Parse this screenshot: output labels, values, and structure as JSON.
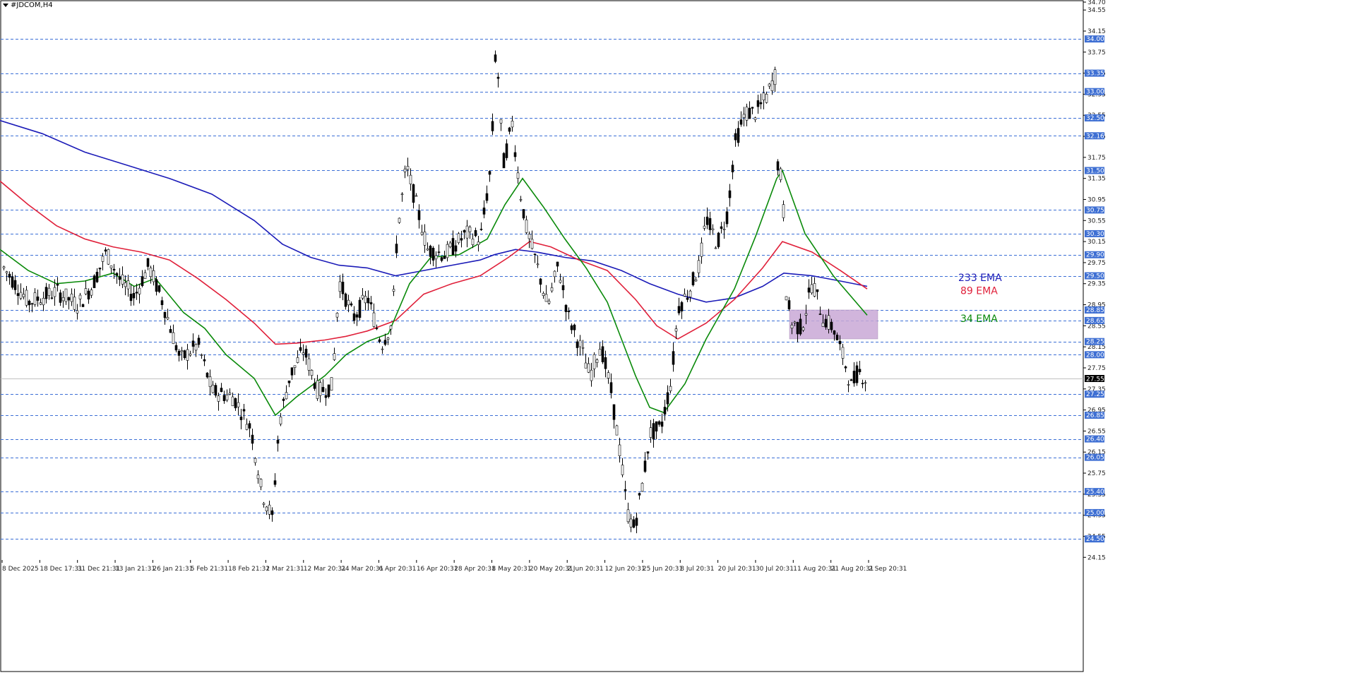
{
  "symbol": "#JDCOM,H4",
  "colors": {
    "grid_line": "#3c6fd6",
    "level_badge": "#3e6fd3",
    "current_badge": "#000000",
    "ema34": "#0a8a0a",
    "ema89": "#e0203a",
    "ema233": "#1b1bb8",
    "zone_fill": "#c9a8d6",
    "candle": "#000000"
  },
  "chart_data": {
    "type": "candlestick",
    "ylim": [
      24.1,
      34.7
    ],
    "price_ticks": [
      "34.70",
      "34.55",
      "34.15",
      "33.75",
      "33.35",
      "32.95",
      "32.55",
      "32.15",
      "31.75",
      "31.35",
      "30.95",
      "30.55",
      "30.15",
      "29.75",
      "29.35",
      "28.95",
      "28.55",
      "28.15",
      "27.75",
      "27.35",
      "26.95",
      "26.55",
      "26.15",
      "25.75",
      "25.35",
      "24.95",
      "24.55",
      "24.15"
    ],
    "horizontal_levels": [
      "34.00",
      "33.35",
      "33.00",
      "32.50",
      "32.16",
      "31.50",
      "30.75",
      "30.30",
      "29.90",
      "29.50",
      "28.85",
      "28.65",
      "28.25",
      "28.00",
      "27.25",
      "26.85",
      "26.40",
      "26.05",
      "25.40",
      "25.00",
      "24.50"
    ],
    "current_price": "27.55",
    "time_labels": [
      "8 Dec 2025",
      "18 Dec 17:31",
      "31 Dec 21:31",
      "13 Jan 21:31",
      "26 Jan 21:31",
      "5 Feb 21:31",
      "18 Feb 21:31",
      "2 Mar 21:31",
      "12 Mar 20:31",
      "24 Mar 20:31",
      "6 Apr 20:31",
      "16 Apr 20:31",
      "28 Apr 20:31",
      "8 May 20:31",
      "20 May 20:31",
      "2 Jun 20:31",
      "12 Jun 20:31",
      "25 Jun 20:31",
      "8 Jul 20:31",
      "20 Jul 20:31",
      "30 Jul 20:31",
      "11 Aug 20:31",
      "21 Aug 20:31",
      "2 Sep 20:31"
    ],
    "series": [
      {
        "name": "233 EMA",
        "color": "#1b1bb8",
        "values": [
          [
            0,
            32.45
          ],
          [
            60,
            32.2
          ],
          [
            120,
            31.85
          ],
          [
            180,
            31.6
          ],
          [
            240,
            31.35
          ],
          [
            300,
            31.05
          ],
          [
            360,
            30.55
          ],
          [
            400,
            30.1
          ],
          [
            440,
            29.85
          ],
          [
            480,
            29.7
          ],
          [
            520,
            29.65
          ],
          [
            560,
            29.5
          ],
          [
            600,
            29.6
          ],
          [
            640,
            29.7
          ],
          [
            680,
            29.8
          ],
          [
            700,
            29.9
          ],
          [
            730,
            30.0
          ],
          [
            760,
            29.95
          ],
          [
            800,
            29.85
          ],
          [
            840,
            29.78
          ],
          [
            880,
            29.6
          ],
          [
            920,
            29.35
          ],
          [
            960,
            29.15
          ],
          [
            1000,
            29.0
          ],
          [
            1040,
            29.08
          ],
          [
            1080,
            29.3
          ],
          [
            1110,
            29.55
          ],
          [
            1150,
            29.5
          ],
          [
            1190,
            29.4
          ],
          [
            1228,
            29.3
          ]
        ]
      },
      {
        "name": "89 EMA",
        "color": "#e0203a",
        "values": [
          [
            0,
            31.3
          ],
          [
            40,
            30.85
          ],
          [
            80,
            30.45
          ],
          [
            120,
            30.2
          ],
          [
            160,
            30.05
          ],
          [
            200,
            29.95
          ],
          [
            240,
            29.8
          ],
          [
            280,
            29.45
          ],
          [
            320,
            29.05
          ],
          [
            360,
            28.6
          ],
          [
            390,
            28.2
          ],
          [
            420,
            28.22
          ],
          [
            460,
            28.28
          ],
          [
            490,
            28.35
          ],
          [
            520,
            28.45
          ],
          [
            560,
            28.65
          ],
          [
            600,
            29.15
          ],
          [
            640,
            29.35
          ],
          [
            680,
            29.5
          ],
          [
            720,
            29.85
          ],
          [
            750,
            30.15
          ],
          [
            780,
            30.05
          ],
          [
            820,
            29.8
          ],
          [
            860,
            29.6
          ],
          [
            900,
            29.05
          ],
          [
            930,
            28.55
          ],
          [
            960,
            28.3
          ],
          [
            1000,
            28.6
          ],
          [
            1040,
            29.05
          ],
          [
            1080,
            29.65
          ],
          [
            1108,
            30.15
          ],
          [
            1150,
            29.95
          ],
          [
            1190,
            29.6
          ],
          [
            1228,
            29.25
          ]
        ]
      },
      {
        "name": "34 EMA",
        "color": "#0a8a0a",
        "values": [
          [
            0,
            30.0
          ],
          [
            40,
            29.6
          ],
          [
            80,
            29.35
          ],
          [
            120,
            29.4
          ],
          [
            160,
            29.55
          ],
          [
            190,
            29.3
          ],
          [
            220,
            29.45
          ],
          [
            260,
            28.8
          ],
          [
            290,
            28.5
          ],
          [
            320,
            28.0
          ],
          [
            360,
            27.55
          ],
          [
            390,
            26.85
          ],
          [
            420,
            27.2
          ],
          [
            460,
            27.6
          ],
          [
            490,
            28.0
          ],
          [
            520,
            28.25
          ],
          [
            550,
            28.4
          ],
          [
            580,
            29.35
          ],
          [
            610,
            29.85
          ],
          [
            650,
            29.9
          ],
          [
            690,
            30.2
          ],
          [
            715,
            30.85
          ],
          [
            740,
            31.35
          ],
          [
            770,
            30.8
          ],
          [
            800,
            30.2
          ],
          [
            830,
            29.65
          ],
          [
            860,
            29.0
          ],
          [
            880,
            28.3
          ],
          [
            900,
            27.6
          ],
          [
            920,
            27.0
          ],
          [
            940,
            26.9
          ],
          [
            970,
            27.45
          ],
          [
            1000,
            28.3
          ],
          [
            1040,
            29.25
          ],
          [
            1070,
            30.25
          ],
          [
            1100,
            31.35
          ],
          [
            1108,
            31.5
          ],
          [
            1140,
            30.3
          ],
          [
            1180,
            29.5
          ],
          [
            1228,
            28.75
          ]
        ]
      }
    ],
    "ema_labels": {
      "ema233": "233 EMA",
      "ema89": "89 EMA",
      "ema34": "34 EMA"
    },
    "zone": {
      "price_top": 28.85,
      "price_bottom": 28.3,
      "x_start_data": 1118,
      "x_end_data": 1243
    },
    "candles_ohlc_summary": "H4 candlesticks Dec 2025 – Sep 2026"
  }
}
